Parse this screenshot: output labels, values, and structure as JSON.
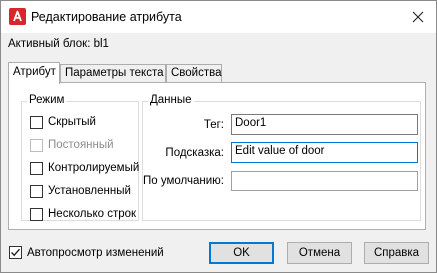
{
  "window": {
    "title": "Редактирование атрибута",
    "close_glyph": "✕",
    "app_icon": "autocad-icon",
    "accent_color": "#d9262c"
  },
  "active_block": "Активный блок: bl1",
  "tabs": [
    {
      "label": "Атрибут",
      "active": true
    },
    {
      "label": "Параметры текста",
      "active": false
    },
    {
      "label": "Свойства",
      "active": false
    }
  ],
  "mode": {
    "title": "Режим",
    "options": [
      {
        "label": "Скрытый",
        "checked": false,
        "enabled": true
      },
      {
        "label": "Постоянный",
        "checked": false,
        "enabled": false
      },
      {
        "label": "Контролируемый",
        "checked": false,
        "enabled": true
      },
      {
        "label": "Установленный",
        "checked": false,
        "enabled": true
      },
      {
        "label": "Несколько строк",
        "checked": false,
        "enabled": true
      }
    ]
  },
  "data": {
    "title": "Данные",
    "tag_label": "Тег:",
    "tag_value": "Door1",
    "prompt_label": "Подсказка:",
    "prompt_value": "Edit value of door",
    "default_label": "По умолчанию:",
    "default_value": ""
  },
  "auto_preview": {
    "label": "Автопросмотр изменений",
    "checked": true
  },
  "buttons": {
    "ok": "OK",
    "cancel": "Отмена",
    "help": "Справка"
  }
}
